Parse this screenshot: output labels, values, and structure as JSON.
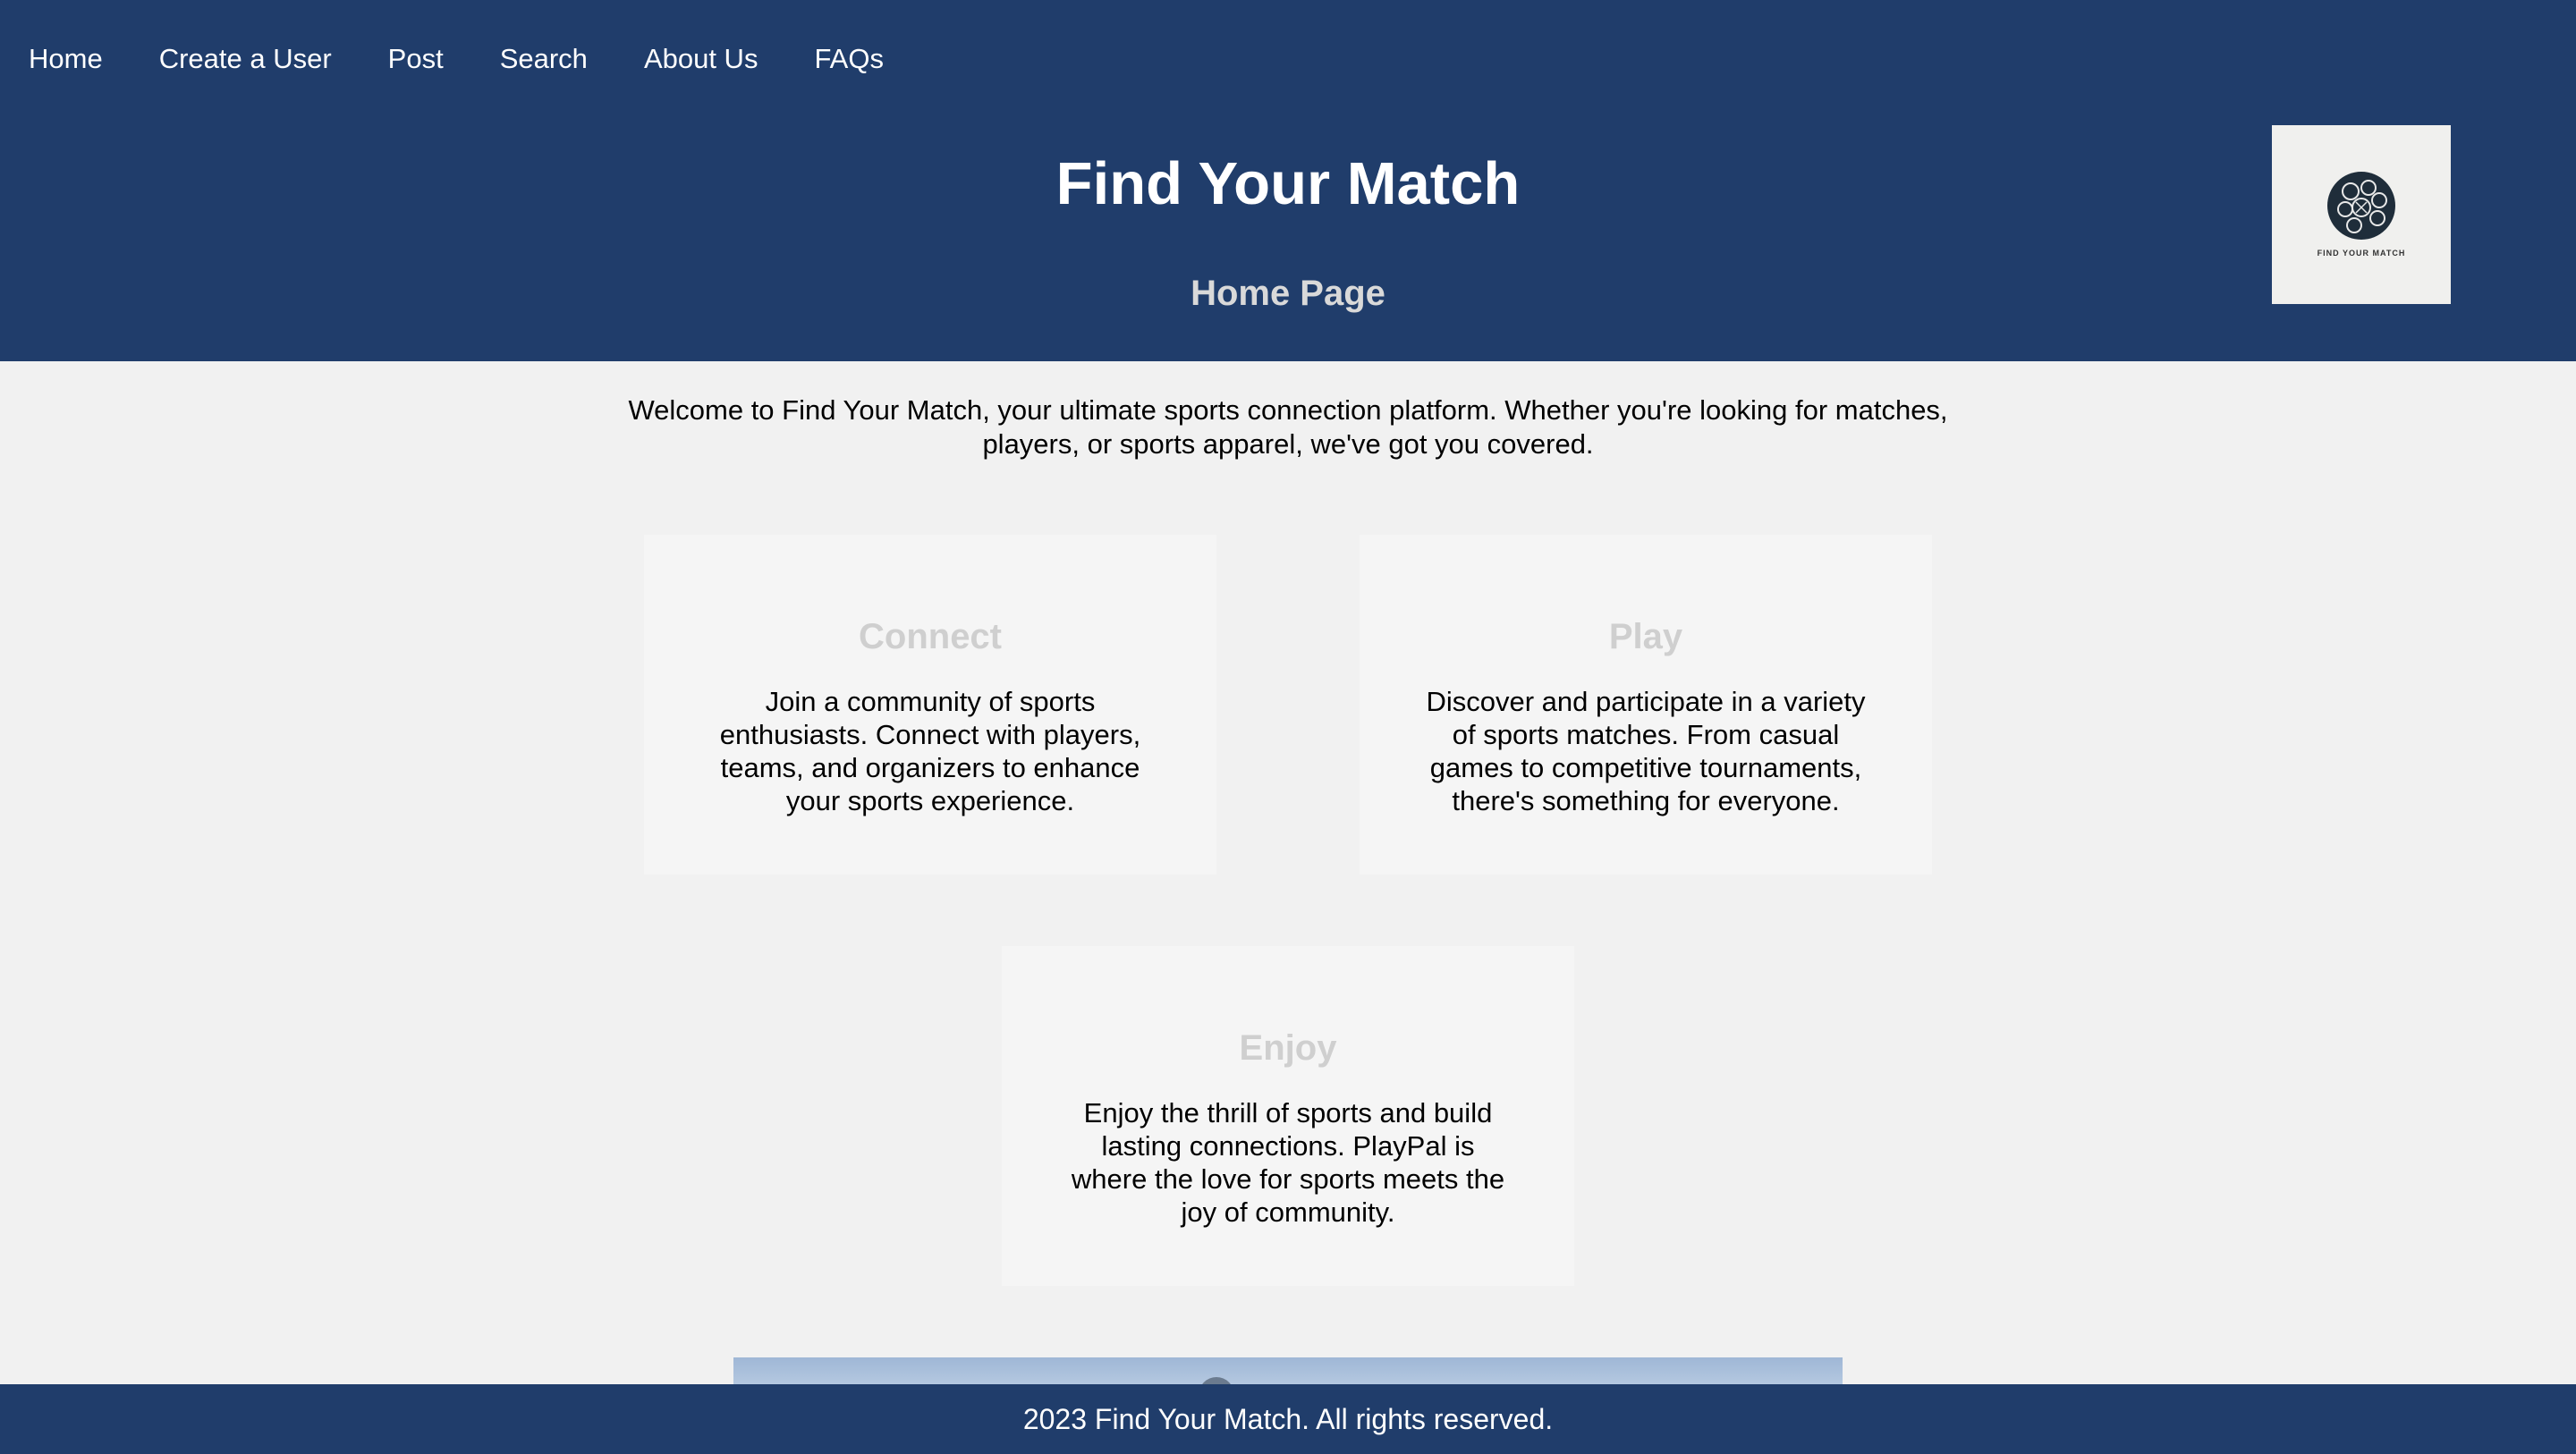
{
  "nav": {
    "items": [
      "Home",
      "Create a User",
      "Post",
      "Search",
      "About Us",
      "FAQs"
    ]
  },
  "header": {
    "title": "Find Your Match",
    "subtitle": "Home Page",
    "logo_text": "FIND YOUR MATCH"
  },
  "main": {
    "intro": "Welcome to Find Your Match, your ultimate sports connection platform. Whether you're looking for matches, players, or sports apparel, we've got you covered.",
    "cards": [
      {
        "title": "Connect",
        "text": "Join a community of sports enthusiasts. Connect with players, teams, and organizers to enhance your sports experience."
      },
      {
        "title": "Play",
        "text": "Discover and participate in a variety of sports matches. From casual games to competitive tournaments, there's something for everyone."
      },
      {
        "title": "Enjoy",
        "text": "Enjoy the thrill of sports and build lasting connections. PlayPal is where the love for sports meets the joy of community."
      }
    ]
  },
  "footer": {
    "text": "2023 Find Your Match. All rights reserved."
  },
  "colors": {
    "header_bg": "#203d6b",
    "page_bg": "#f1f1f1",
    "card_bg": "#f5f5f5",
    "card_title": "#cfcfcf"
  }
}
